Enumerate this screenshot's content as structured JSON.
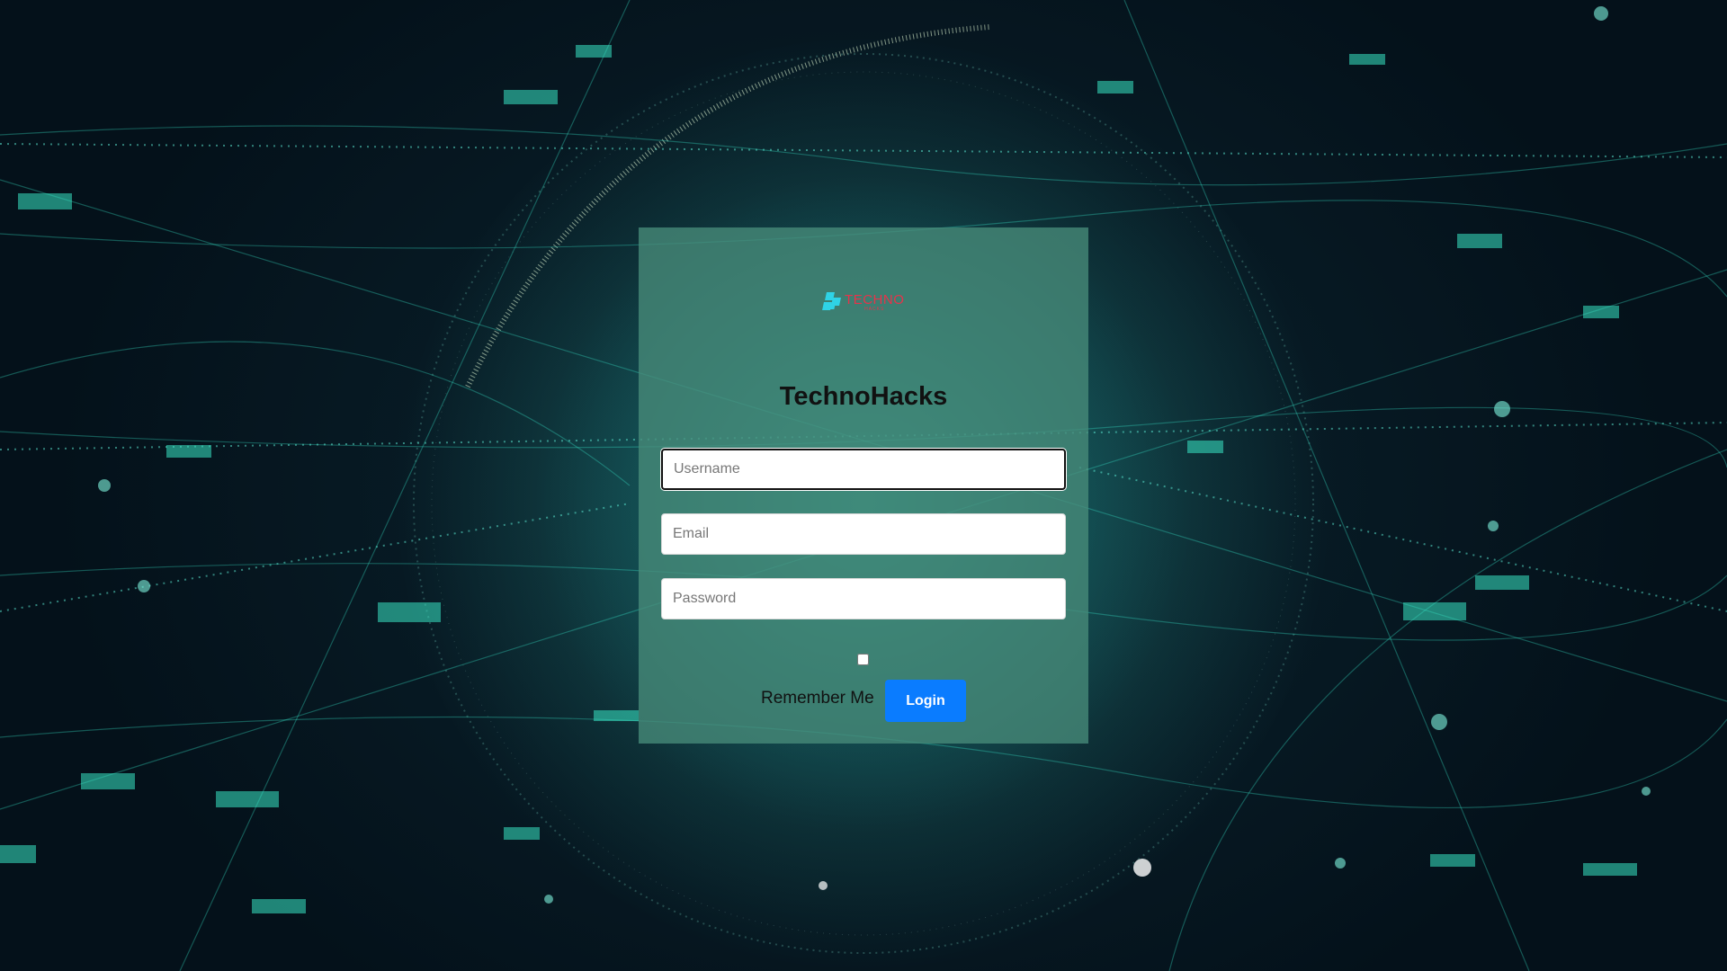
{
  "logo": {
    "brand_text": "TECHNO",
    "tagline": "HACKS",
    "mark_icon": "techno-logo-mark",
    "brand_color": "#e8324a",
    "mark_color": "#2fd3e6"
  },
  "form": {
    "title": "TechnoHacks",
    "username": {
      "value": "",
      "placeholder": "Username"
    },
    "email": {
      "value": "",
      "placeholder": "Email"
    },
    "password": {
      "value": "",
      "placeholder": "Password"
    },
    "remember_label": "Remember Me",
    "remember_checked": false,
    "login_label": "Login"
  },
  "colors": {
    "button": "#0a7cff",
    "card": "rgba(72,140,122,0.78)",
    "background": "#071a24"
  }
}
